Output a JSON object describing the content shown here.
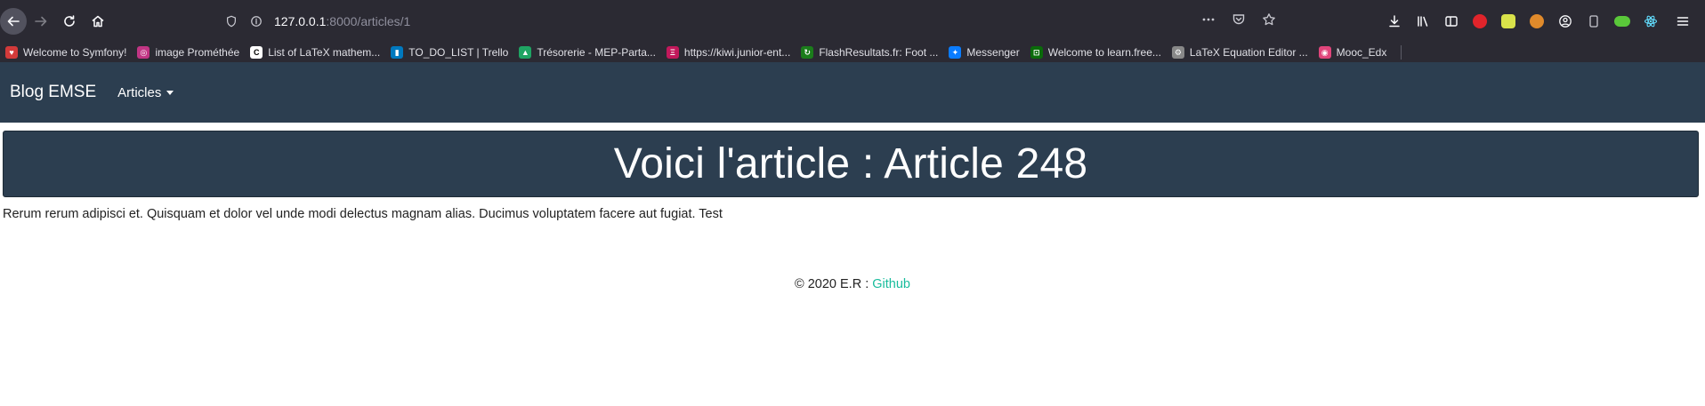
{
  "browser": {
    "url_host": "127.0.0.1",
    "url_rest": ":8000/articles/1",
    "bookmarks": [
      {
        "label": "Welcome to Symfony!",
        "color": "#d33a3a",
        "glyph": "♥"
      },
      {
        "label": "image  Prométhée",
        "color": "#c13584",
        "glyph": "◎"
      },
      {
        "label": "List of LaTeX mathem...",
        "color": "#ffffff",
        "glyph": "C"
      },
      {
        "label": "TO_DO_LIST | Trello",
        "color": "#0079bf",
        "glyph": "▮"
      },
      {
        "label": "Trésorerie - MEP-Parta...",
        "color": "#1fa463",
        "glyph": "▲"
      },
      {
        "label": "https://kiwi.junior-ent...",
        "color": "#c2185b",
        "glyph": "Ξ"
      },
      {
        "label": "FlashResultats.fr: Foot ...",
        "color": "#1b7d1b",
        "glyph": "↻"
      },
      {
        "label": "Messenger",
        "color": "#0a7cff",
        "glyph": "✦"
      },
      {
        "label": "Welcome to learn.free...",
        "color": "#0a6b0a",
        "glyph": "⊡"
      },
      {
        "label": "LaTeX Equation Editor ...",
        "color": "#888888",
        "glyph": "⚙"
      },
      {
        "label": "Mooc_Edx",
        "color": "#e0457b",
        "glyph": "◉"
      }
    ]
  },
  "site": {
    "brand": "Blog EMSE",
    "nav_articles": "Articles",
    "heading": "Voici l'article : Article 248",
    "body": "Rerum rerum adipisci et. Quisquam et dolor vel unde modi delectus magnam alias. Ducimus voluptatem facere aut fugiat. Test",
    "footer_text": "© 2020 E.R : ",
    "footer_link": "Github",
    "colors": {
      "navbar": "#2c3e50",
      "link": "#18bc9c"
    }
  }
}
